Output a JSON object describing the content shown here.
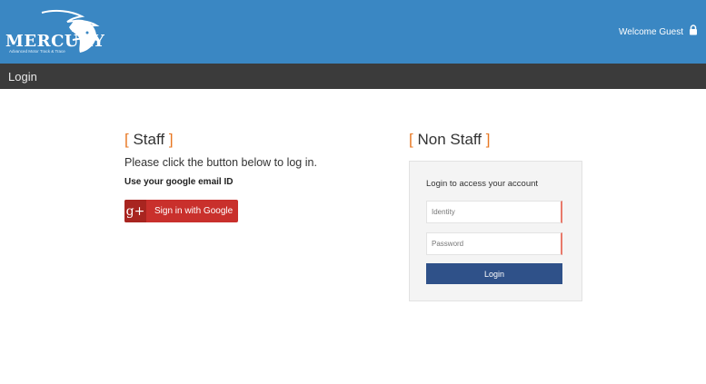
{
  "header": {
    "logo_text": "MERCURY",
    "logo_subtitle": "Advanced Motor Track & Trace",
    "welcome_text": "Welcome Guest",
    "background_color": "#3a87c3",
    "lock_icon": "lock-icon"
  },
  "titlebar": {
    "title": "Login",
    "background_color": "#3b3b3b"
  },
  "staff": {
    "open_bracket": "[",
    "title": "Staff",
    "close_bracket": "]",
    "instruction": "Please click the button below to log in.",
    "email_note": "Use your google email ID",
    "google_button": {
      "icon_glyph": "g+",
      "label": "Sign in with Google",
      "color": "#c9302c"
    }
  },
  "non_staff": {
    "open_bracket": "[",
    "title": "Non Staff",
    "close_bracket": "]",
    "form": {
      "heading": "Login to access your account",
      "identity_placeholder": "Identity",
      "password_placeholder": "Password",
      "submit_label": "Login",
      "submit_color": "#2f5189"
    }
  },
  "accent_color": "#e87722"
}
